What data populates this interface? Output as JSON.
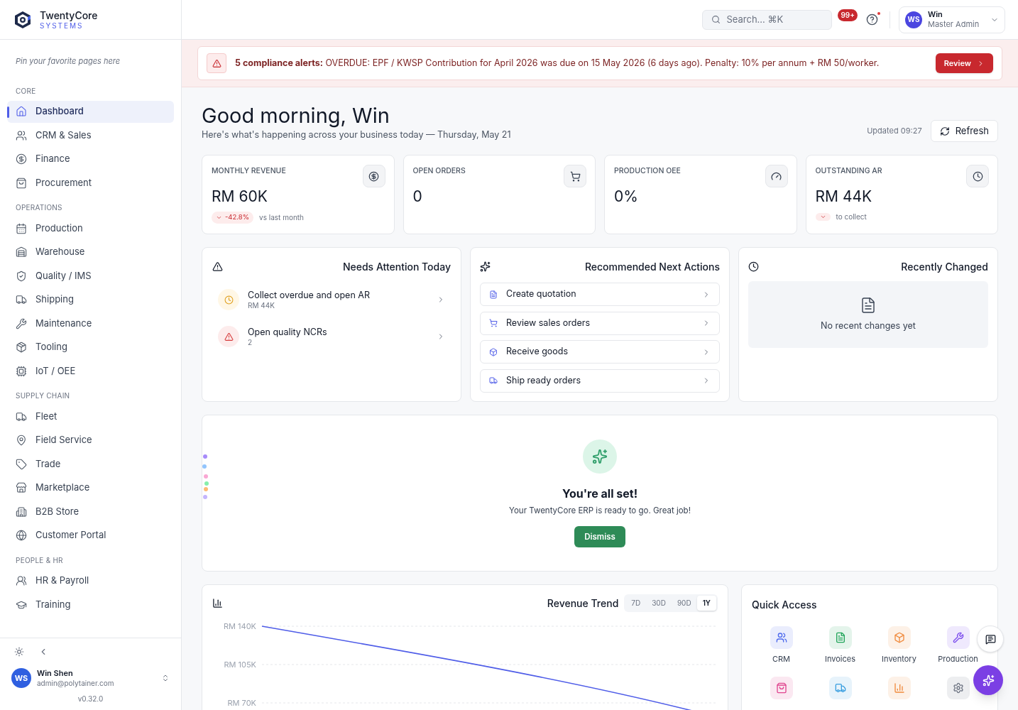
{
  "brand": {
    "name": "TwentyCore",
    "tagline": "SYSTEMS"
  },
  "sidebar": {
    "pin_hint": "Pin your favorite pages here",
    "sections": [
      {
        "title": "CORE",
        "items": [
          {
            "label": "Dashboard",
            "selected": true
          },
          {
            "label": "CRM & Sales",
            "selected": false
          },
          {
            "label": "Finance",
            "selected": false
          },
          {
            "label": "Procurement",
            "selected": false
          }
        ]
      },
      {
        "title": "OPERATIONS",
        "items": [
          {
            "label": "Production",
            "selected": false
          },
          {
            "label": "Warehouse",
            "selected": false
          },
          {
            "label": "Quality / IMS",
            "selected": false
          },
          {
            "label": "Shipping",
            "selected": false
          },
          {
            "label": "Maintenance",
            "selected": false
          },
          {
            "label": "Tooling",
            "selected": false
          },
          {
            "label": "IoT / OEE",
            "selected": false
          }
        ]
      },
      {
        "title": "SUPPLY CHAIN",
        "items": [
          {
            "label": "Fleet",
            "selected": false
          },
          {
            "label": "Field Service",
            "selected": false
          },
          {
            "label": "Trade",
            "selected": false
          },
          {
            "label": "Marketplace",
            "selected": false
          },
          {
            "label": "B2B Store",
            "selected": false
          },
          {
            "label": "Customer Portal",
            "selected": false
          }
        ]
      },
      {
        "title": "PEOPLE & HR",
        "items": [
          {
            "label": "HR & Payroll",
            "selected": false
          },
          {
            "label": "Training",
            "selected": false
          }
        ]
      }
    ],
    "user": {
      "initials": "WS",
      "name": "Win Shen",
      "email": "admin@polytainer.com"
    },
    "version": "v0.32.0"
  },
  "topbar": {
    "search_placeholder": "Search... ⌘K",
    "notification_count": "99+",
    "help_dot": true,
    "user": {
      "initials": "WS",
      "name": "Win",
      "role": "Master Admin"
    }
  },
  "alert": {
    "title": "5 compliance alerts:",
    "message": "OVERDUE: EPF / KWSP Contribution for April 2026 was due on 15 May 2026 (6 days ago). Penalty: 10% per annum + RM 50/worker.",
    "button": "Review"
  },
  "greeting": {
    "title": "Good morning, Win",
    "subtitle": "Here's what's happening across your business today — Thursday, May 21",
    "updated": "Updated 09:27",
    "refresh": "Refresh"
  },
  "kpis": [
    {
      "label": "MONTHLY REVENUE",
      "value": "RM 60K",
      "change": "-42.8%",
      "note": "vs last month"
    },
    {
      "label": "OPEN ORDERS",
      "value": "0"
    },
    {
      "label": "PRODUCTION OEE",
      "value": "0%"
    },
    {
      "label": "OUTSTANDING AR",
      "value": "RM 44K",
      "note": "to collect"
    }
  ],
  "attention": {
    "title": "Needs Attention Today",
    "items": [
      {
        "kind": "warning",
        "title": "Collect overdue and open AR",
        "detail": "RM 44K"
      },
      {
        "kind": "danger",
        "title": "Open quality NCRs",
        "detail": "2"
      }
    ]
  },
  "actions": {
    "title": "Recommended Next Actions",
    "items": [
      "Create quotation",
      "Review sales orders",
      "Receive goods",
      "Ship ready orders"
    ]
  },
  "recent": {
    "title": "Recently Changed",
    "empty": "No recent changes yet"
  },
  "welcome": {
    "title": "You're all set!",
    "message": "Your TwentyCore ERP is ready to go. Great job!",
    "button": "Dismiss"
  },
  "revenue": {
    "title": "Revenue Trend",
    "ranges": [
      {
        "label": "7D",
        "selected": false
      },
      {
        "label": "30D",
        "selected": false
      },
      {
        "label": "90D",
        "selected": false
      },
      {
        "label": "1Y",
        "selected": true
      }
    ],
    "y_axis_labels": [
      "RM 140K",
      "RM 105K",
      "RM 70K"
    ]
  },
  "quick_access": {
    "title": "Quick Access",
    "items": [
      {
        "label": "CRM",
        "color": "#4f6bed"
      },
      {
        "label": "Invoices",
        "color": "#22a55b"
      },
      {
        "label": "Inventory",
        "color": "#f08a3c"
      },
      {
        "label": "Production",
        "color": "#7c4ded"
      },
      {
        "color": "#e0458f"
      },
      {
        "color": "#3b9fe0"
      },
      {
        "color": "#f08a3c"
      },
      {
        "color": "#6b7280"
      }
    ]
  }
}
